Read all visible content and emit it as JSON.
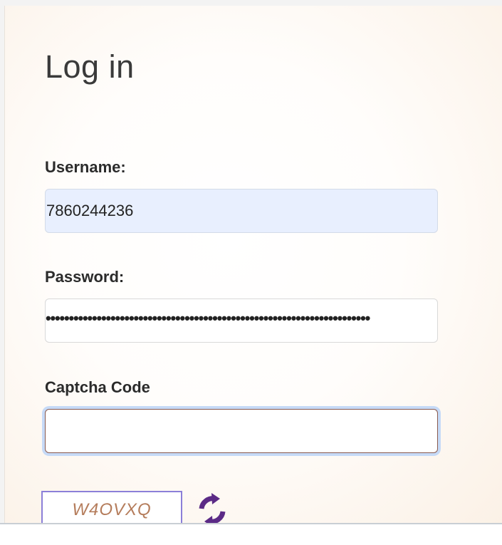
{
  "login": {
    "title": "Log in",
    "username_label": "Username:",
    "username_value": "7860244236",
    "password_label": "Password:",
    "password_mask": "••••••••••••••••••••••••••••••••••••••••••••••••••••••••••••••••••••••",
    "captcha_label": "Captcha Code",
    "captcha_value": "",
    "captcha_image_text": "W4OVXQ",
    "refresh_icon": "refresh-icon"
  },
  "colors": {
    "focus_ring": "#c6daf7",
    "autofill_bg": "#e8effe",
    "captcha_text": "#b57d5c",
    "refresh_icon": "#5b2a86"
  }
}
